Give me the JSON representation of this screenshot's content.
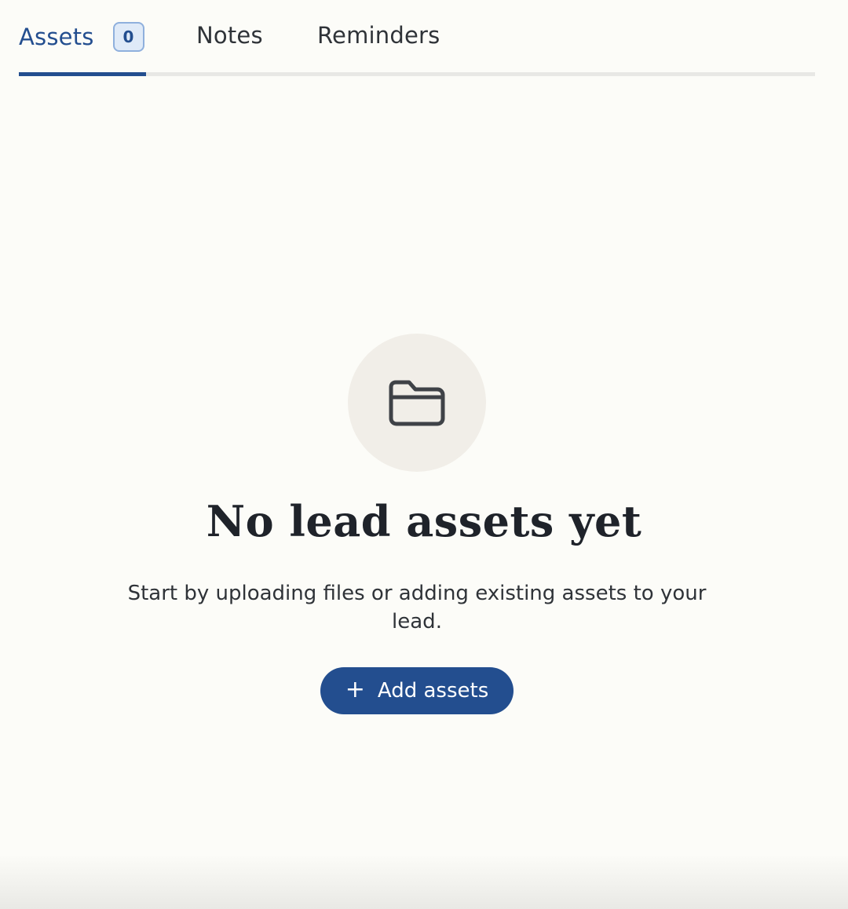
{
  "tabs": [
    {
      "label": "Assets",
      "badge": "0",
      "active": true
    },
    {
      "label": "Notes",
      "active": false
    },
    {
      "label": "Reminders",
      "active": false
    }
  ],
  "empty_state": {
    "icon": "folder-icon",
    "title": "No lead assets yet",
    "description": "Start by uploading files or adding existing assets to your lead.",
    "button_label": "Add assets",
    "button_icon": "plus-icon"
  },
  "colors": {
    "accent": "#234e8f",
    "background": "#fcfcf8",
    "icon_circle": "#f1eee8",
    "badge_bg": "#dfeaf8",
    "badge_border": "#8fb0dd"
  }
}
